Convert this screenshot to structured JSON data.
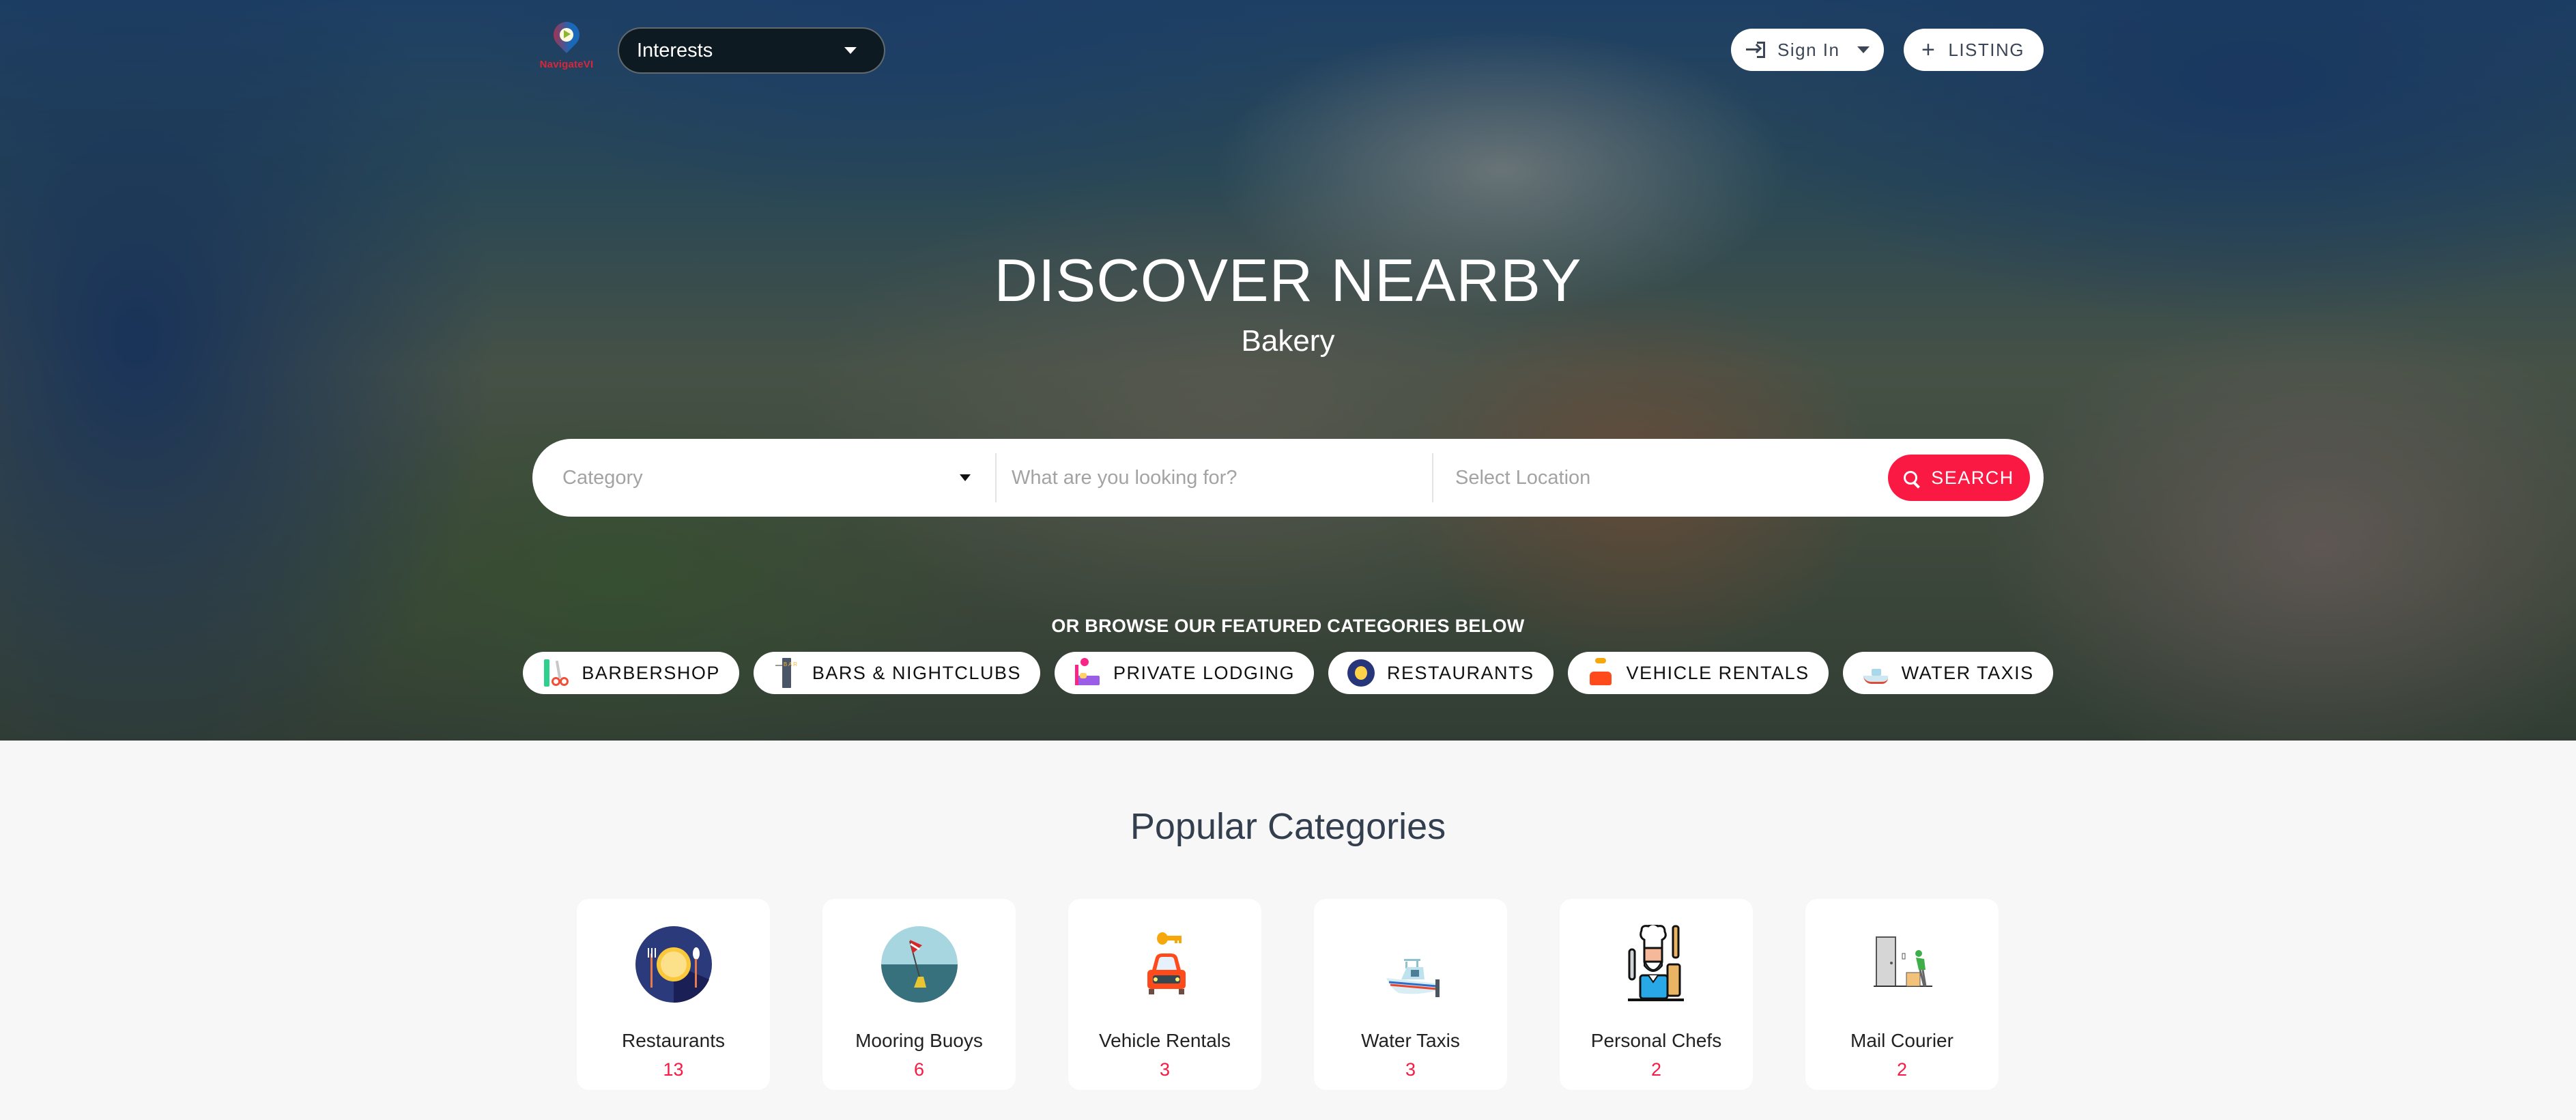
{
  "header": {
    "logo_text": "NavigateVI",
    "interests_label": "Interests",
    "sign_in_label": "Sign In",
    "listing_label": "LISTING"
  },
  "hero": {
    "title": "DISCOVER NEARBY",
    "subtitle": "Bakery"
  },
  "search": {
    "category_placeholder": "Category",
    "what_placeholder": "What are you looking for?",
    "location_placeholder": "Select Location",
    "search_label": "SEARCH"
  },
  "featured": {
    "label": "OR BROWSE OUR FEATURED CATEGORIES BELOW",
    "items": [
      {
        "label": "BARBERSHOP",
        "icon": "barbershop-icon"
      },
      {
        "label": "BARS & NIGHTCLUBS",
        "icon": "bar-sign-icon"
      },
      {
        "label": "PRIVATE LODGING",
        "icon": "bed-icon"
      },
      {
        "label": "RESTAURANTS",
        "icon": "plate-cutlery-icon"
      },
      {
        "label": "VEHICLE RENTALS",
        "icon": "car-key-icon"
      },
      {
        "label": "WATER TAXIS",
        "icon": "boat-icon"
      }
    ]
  },
  "popular": {
    "title": "Popular Categories",
    "items": [
      {
        "name": "Restaurants",
        "count": "13",
        "icon": "plate-cutlery-icon"
      },
      {
        "name": "Mooring Buoys",
        "count": "6",
        "icon": "buoy-icon"
      },
      {
        "name": "Vehicle Rentals",
        "count": "3",
        "icon": "car-key-icon"
      },
      {
        "name": "Water Taxis",
        "count": "3",
        "icon": "boat-icon"
      },
      {
        "name": "Personal Chefs",
        "count": "2",
        "icon": "chef-icon"
      },
      {
        "name": "Mail Courier",
        "count": "2",
        "icon": "courier-icon"
      }
    ]
  },
  "colors": {
    "accent": "#f91942",
    "dropdown_bg": "#0e1a22",
    "heading": "#333e4f",
    "page_bg": "#f7f7f7"
  }
}
